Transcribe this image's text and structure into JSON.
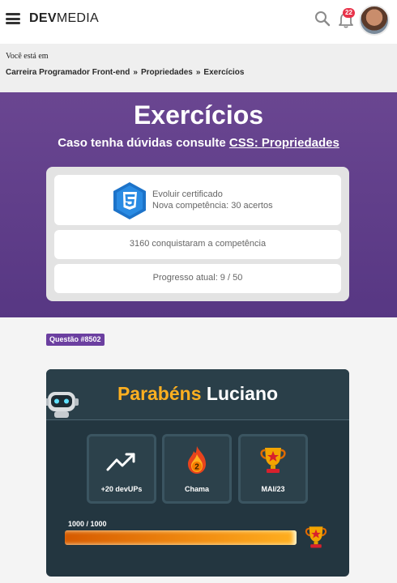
{
  "header": {
    "logo_bold": "DEV",
    "logo_light": "MEDIA",
    "notification_count": "22",
    "icons": [
      "hamburger-icon",
      "search-icon",
      "bell-icon"
    ]
  },
  "breadcrumb": {
    "intro": "Você está em",
    "items": [
      "Carreira Programador Front-end",
      "Propriedades",
      "Exercícios"
    ],
    "separator": "»"
  },
  "hero": {
    "title": "Exercícios",
    "subtitle_prefix": "Caso tenha dúvidas consulte ",
    "subtitle_link": "CSS: Propriedades",
    "cert_line1": "Evoluir certificado",
    "cert_line2": "Nova competência: 30 acertos",
    "conquered": "3160 conquistaram a competência",
    "progress": "Progresso atual: 9 / 50",
    "css_badge_icon": "css3-shield-icon"
  },
  "question": {
    "tag": "Questão #8502"
  },
  "congrats": {
    "word": "Parabéns",
    "name": "Luciano",
    "stats": [
      {
        "icon": "trending-up-icon",
        "label": "+20 devUPs"
      },
      {
        "icon": "flame-icon",
        "label": "Chama",
        "flame_number": "2"
      },
      {
        "icon": "trophy-icon",
        "label": "MAI/23"
      }
    ],
    "xp_text": "1000 / 1000",
    "xp_fraction": 1.0
  },
  "colors": {
    "hero_bg": "#6a4691",
    "tag_bg": "#6b3fa0",
    "panel_bg": "#233640",
    "gold": "#ffb020",
    "css_blue": "#1d73c9"
  }
}
